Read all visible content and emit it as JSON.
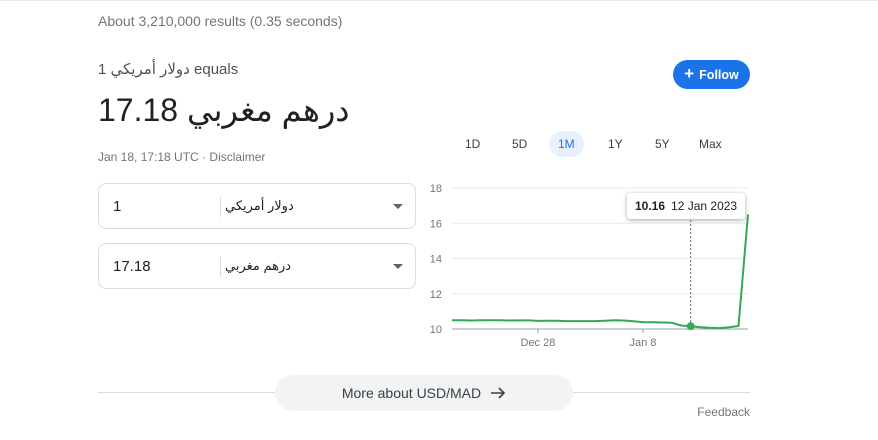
{
  "results_stats": "About 3,210,000 results (0.35 seconds)",
  "converter": {
    "equals_text": "1 دولار أمريكي equals",
    "result_text": "17.18 درهم مغربي",
    "timestamp": "Jan 18, 17:18 UTC",
    "separator": "·",
    "disclaimer": "Disclaimer",
    "follow_plus": "+",
    "follow_label": "Follow",
    "from": {
      "value": "1",
      "currency": "دولار أمريكي"
    },
    "to": {
      "value": "17.18",
      "currency": "درهم مغربي"
    }
  },
  "range_tabs": [
    "1D",
    "5D",
    "1M",
    "1Y",
    "5Y",
    "Max"
  ],
  "active_tab": "1M",
  "tooltip": {
    "value": "10.16",
    "date": "12 Jan 2023"
  },
  "more_button": "More about USD/MAD",
  "feedback": "Feedback",
  "colors": {
    "accent": "#1a73e8",
    "line": "#34a853",
    "text_secondary": "#70757a"
  },
  "chart_data": {
    "type": "line",
    "title": "",
    "xlabel": "",
    "ylabel": "",
    "ylim": [
      10,
      18
    ],
    "yticks": [
      10,
      12,
      14,
      16,
      18
    ],
    "x_labels": [
      {
        "label": "Dec 28",
        "index": 9
      },
      {
        "label": "Jan 8",
        "index": 20
      }
    ],
    "series": [
      {
        "values": [
          10.5,
          10.5,
          10.48,
          10.5,
          10.5,
          10.5,
          10.48,
          10.49,
          10.49,
          10.46,
          10.47,
          10.47,
          10.45,
          10.45,
          10.45,
          10.45,
          10.47,
          10.5,
          10.48,
          10.44,
          10.38,
          10.38,
          10.37,
          10.36,
          10.2,
          10.16,
          10.1,
          10.07,
          10.05,
          10.1,
          10.17,
          16.5
        ]
      }
    ],
    "highlight": {
      "index": 25,
      "value": 10.16
    },
    "grid": true
  }
}
